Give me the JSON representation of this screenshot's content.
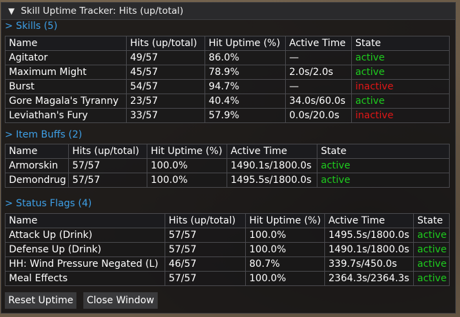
{
  "window": {
    "title": "Skill Uptime Tracker: Hits (up/total)",
    "collapse_icon": "triangle-down-icon"
  },
  "sections": {
    "skills": {
      "header": "> Skills (5)"
    },
    "item_buffs": {
      "header": "> Item Buffs (2)"
    },
    "status_flags": {
      "header": "> Status Flags (4)"
    }
  },
  "columns": {
    "name": "Name",
    "hits": "Hits (up/total)",
    "uptime": "Hit Uptime (%)",
    "active_time": "Active Time",
    "state": "State"
  },
  "skills": [
    {
      "name": "Agitator",
      "hits": "49/57",
      "uptime": "86.0%",
      "active_time": "—",
      "state": "active"
    },
    {
      "name": "Maximum Might",
      "hits": "45/57",
      "uptime": "78.9%",
      "active_time": "2.0s/2.0s",
      "state": "active"
    },
    {
      "name": "Burst",
      "hits": "54/57",
      "uptime": "94.7%",
      "active_time": "—",
      "state": "inactive"
    },
    {
      "name": "Gore Magala's Tyranny",
      "hits": "23/57",
      "uptime": "40.4%",
      "active_time": "34.0s/60.0s",
      "state": "active"
    },
    {
      "name": "Leviathan's Fury",
      "hits": "33/57",
      "uptime": "57.9%",
      "active_time": "0.0s/20.0s",
      "state": "inactive"
    }
  ],
  "item_buffs": [
    {
      "name": "Armorskin",
      "hits": "57/57",
      "uptime": "100.0%",
      "active_time": "1490.1s/1800.0s",
      "state": "active"
    },
    {
      "name": "Demondrug",
      "hits": "57/57",
      "uptime": "100.0%",
      "active_time": "1495.5s/1800.0s",
      "state": "active"
    }
  ],
  "status_flags": [
    {
      "name": "Attack Up (Drink)",
      "hits": "57/57",
      "uptime": "100.0%",
      "active_time": "1495.5s/1800.0s",
      "state": "active"
    },
    {
      "name": "Defense Up (Drink)",
      "hits": "57/57",
      "uptime": "100.0%",
      "active_time": "1490.1s/1800.0s",
      "state": "active"
    },
    {
      "name": "HH: Wind Pressure Negated (L)",
      "hits": "46/57",
      "uptime": "80.7%",
      "active_time": "339.7s/450.0s",
      "state": "active"
    },
    {
      "name": "Meal Effects",
      "hits": "57/57",
      "uptime": "100.0%",
      "active_time": "2364.3s/2364.3s",
      "state": "active"
    }
  ],
  "buttons": {
    "reset": "Reset Uptime",
    "close": "Close Window"
  },
  "colors": {
    "accent": "#3ea0e8",
    "active": "#1ecc1e",
    "inactive": "#e01616"
  }
}
